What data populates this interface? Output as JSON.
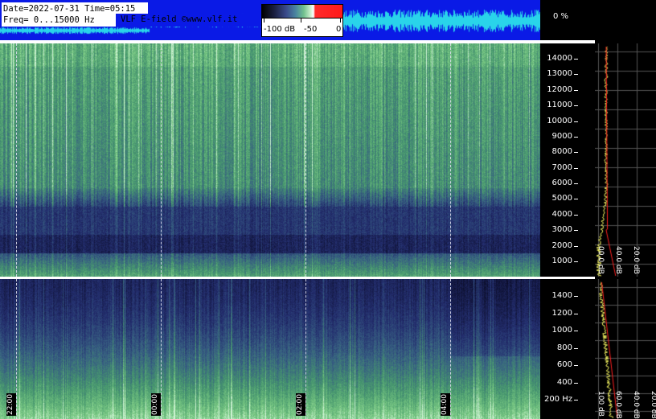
{
  "header": {
    "date_line": "Date=2022-07-31 Time=05:15",
    "freq_line": "Freq= 0...15000 Hz",
    "field_line": "VLF E-field ©www.vlf.it"
  },
  "colorbar": {
    "ticks": [
      "-100 dB",
      "-50",
      "0"
    ]
  },
  "level": {
    "percent_label": "0 %"
  },
  "panel_top": {
    "freq_ticks": [
      "14000",
      "13000",
      "12000",
      "11000",
      "10000",
      "9000",
      "8000",
      "7000",
      "6000",
      "5000",
      "4000",
      "3000",
      "2000",
      "1000"
    ],
    "db_labels": [
      "00.0 dB",
      "40.0 dB",
      "20.0 dB"
    ]
  },
  "panel_bottom": {
    "freq_ticks": [
      "1400",
      "1200",
      "1000",
      "800",
      "600",
      "400",
      "200 Hz"
    ],
    "db_labels": [
      "100 dB",
      "60.0 dB",
      "40.0 dB",
      "20.0 dB"
    ]
  },
  "time_markers": [
    "22:00",
    "00:00",
    "02:00",
    "04:00"
  ],
  "colors": {
    "wave_bg": "#0a1ae6",
    "wave_line": "#29d4ea",
    "profile_yellow": "#f0f060",
    "profile_red": "#ff2020"
  }
}
